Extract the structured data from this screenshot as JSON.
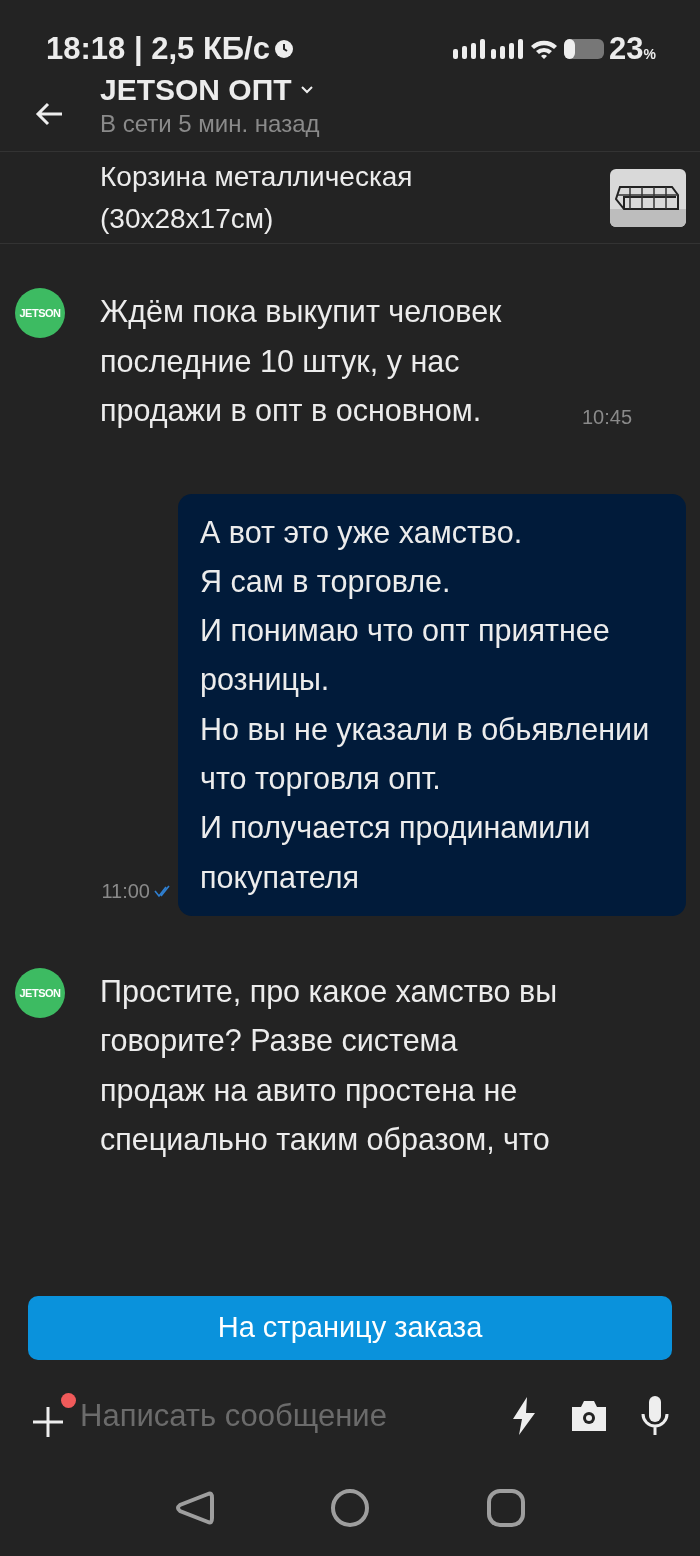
{
  "status_bar": {
    "time": "18:18 | 2,5 КБ/с",
    "battery": "23",
    "battery_unit": "%"
  },
  "header": {
    "title": "JETSON ОПТ",
    "subtitle": "В сети 5 мин. назад"
  },
  "product": {
    "title": "Корзина металлическая (30x28x17см)"
  },
  "messages": [
    {
      "kind": "incoming",
      "avatar": "JETSON",
      "text": "Ждём пока выкупит человек последние 10 штук, у нас продажи в опт в основном.",
      "time": "10:45"
    },
    {
      "kind": "outgoing",
      "text": "А вот это уже хамство.\nЯ сам в торговле.\nИ понимаю что опт приятнее розницы.\nНо вы не указали в обьявлении что торговля опт.\nИ получается продинамили покупателя",
      "time": "11:00",
      "read": true
    },
    {
      "kind": "incoming",
      "avatar": "JETSON",
      "text": "Простите, про какое хамство вы говорите? Разве система продаж на авито простена не специально таким образом, что"
    }
  ],
  "order_button": "На страницу заказа",
  "composer": {
    "placeholder": "Написать сообщение",
    "attach_badge": true
  }
}
